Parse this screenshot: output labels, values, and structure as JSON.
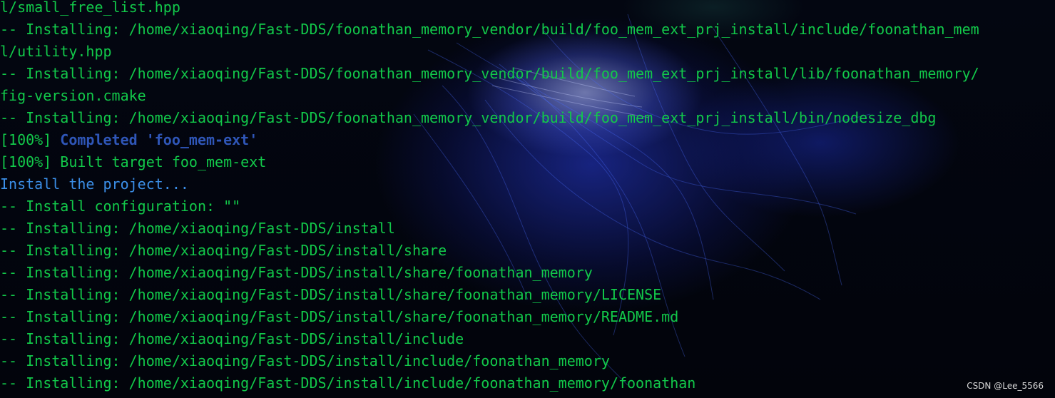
{
  "terminal": {
    "lines": [
      "l/small_free_list.hpp",
      "-- Installing: /home/xiaoqing/Fast-DDS/foonathan_memory_vendor/build/foo_mem_ext_prj_install/include/foonathan_mem",
      "l/utility.hpp",
      "-- Installing: /home/xiaoqing/Fast-DDS/foonathan_memory_vendor/build/foo_mem_ext_prj_install/lib/foonathan_memory/",
      "fig-version.cmake",
      "-- Installing: /home/xiaoqing/Fast-DDS/foonathan_memory_vendor/build/foo_mem_ext_prj_install/bin/nodesize_dbg",
      "-- Install configuration: \"\"",
      "-- Installing: /home/xiaoqing/Fast-DDS/install",
      "-- Installing: /home/xiaoqing/Fast-DDS/install/share",
      "-- Installing: /home/xiaoqing/Fast-DDS/install/share/foonathan_memory",
      "-- Installing: /home/xiaoqing/Fast-DDS/install/share/foonathan_memory/LICENSE",
      "-- Installing: /home/xiaoqing/Fast-DDS/install/share/foonathan_memory/README.md",
      "-- Installing: /home/xiaoqing/Fast-DDS/install/include",
      "-- Installing: /home/xiaoqing/Fast-DDS/install/include/foonathan_memory",
      "-- Installing: /home/xiaoqing/Fast-DDS/install/include/foonathan_memory/foonathan"
    ],
    "completed_line": {
      "prefix": "[100%] ",
      "highlight": "Completed 'foo_mem-ext'"
    },
    "built_line": "[100%] Built target foo_mem-ext",
    "install_project_line": "Install the project..."
  },
  "watermark": "CSDN @Lee_5566",
  "colors": {
    "text_green": "#12c94a",
    "completed_blue": "#2f56b8",
    "info_blue": "#3b8fe8",
    "background": "#02040a"
  }
}
